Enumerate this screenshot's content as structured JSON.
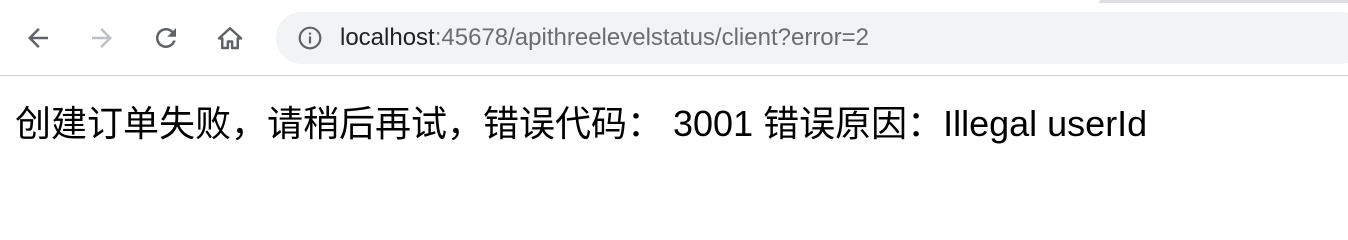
{
  "browser": {
    "nav": {
      "back_icon": "arrow-left-icon",
      "forward_icon": "arrow-right-icon",
      "reload_icon": "reload-icon",
      "home_icon": "home-icon"
    },
    "address_bar": {
      "info_icon": "info-icon",
      "url_host": "localhost",
      "url_rest": ":45678/apithreelevelstatus/client?error=2"
    }
  },
  "page": {
    "message": "创建订单失败，请稍后再试，错误代码： 3001 错误原因：Illegal userId"
  }
}
